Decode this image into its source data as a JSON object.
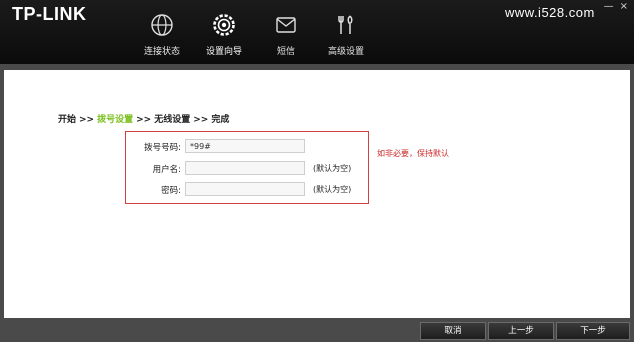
{
  "header": {
    "logo": "TP-LINK",
    "watermark": "www.i528.com",
    "window_controls": [
      "—",
      "×"
    ],
    "nav": [
      {
        "label": "连接状态",
        "icon": "globe-icon"
      },
      {
        "label": "设置向导",
        "icon": "settings-icon",
        "active": true
      },
      {
        "label": "短信",
        "icon": "mail-icon"
      },
      {
        "label": "高级设置",
        "icon": "tools-icon"
      }
    ]
  },
  "wizard": {
    "steps": [
      "开始",
      ">>",
      "拨号设置",
      ">>",
      "无线设置",
      ">>",
      "完成"
    ],
    "current_step_color": "#7cc01f"
  },
  "form": {
    "dial_number": {
      "label": "拨号号码:",
      "value": "*99#"
    },
    "username": {
      "label": "用户名:",
      "value": "",
      "hint": "(默认为空)"
    },
    "password": {
      "label": "密码:",
      "value": "",
      "hint": "(默认为空)"
    },
    "note": "如非必要，保持默认"
  },
  "footer": {
    "cancel": "取消",
    "prev": "上一步",
    "next": "下一步"
  },
  "colors": {
    "accent": "#7cc01f",
    "warning": "#cc2a2a",
    "border_highlight": "#d14040"
  }
}
